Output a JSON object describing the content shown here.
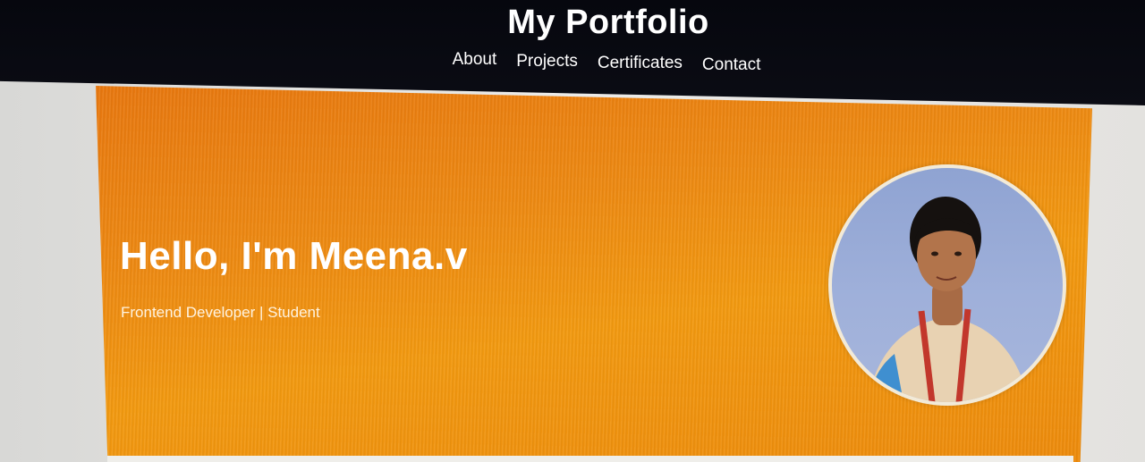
{
  "header": {
    "site_title": "My Portfolio",
    "nav": [
      {
        "label": "About"
      },
      {
        "label": "Projects"
      },
      {
        "label": "Certificates"
      },
      {
        "label": "Contact"
      }
    ]
  },
  "hero": {
    "title": "Hello, I'm Meena.v",
    "subtitle": "Frontend Developer | Student",
    "avatar_icon": "profile-photo",
    "colors": {
      "header_bg": "#06070e",
      "hero_orange": "#ee8a12",
      "text": "#ffffff"
    }
  }
}
